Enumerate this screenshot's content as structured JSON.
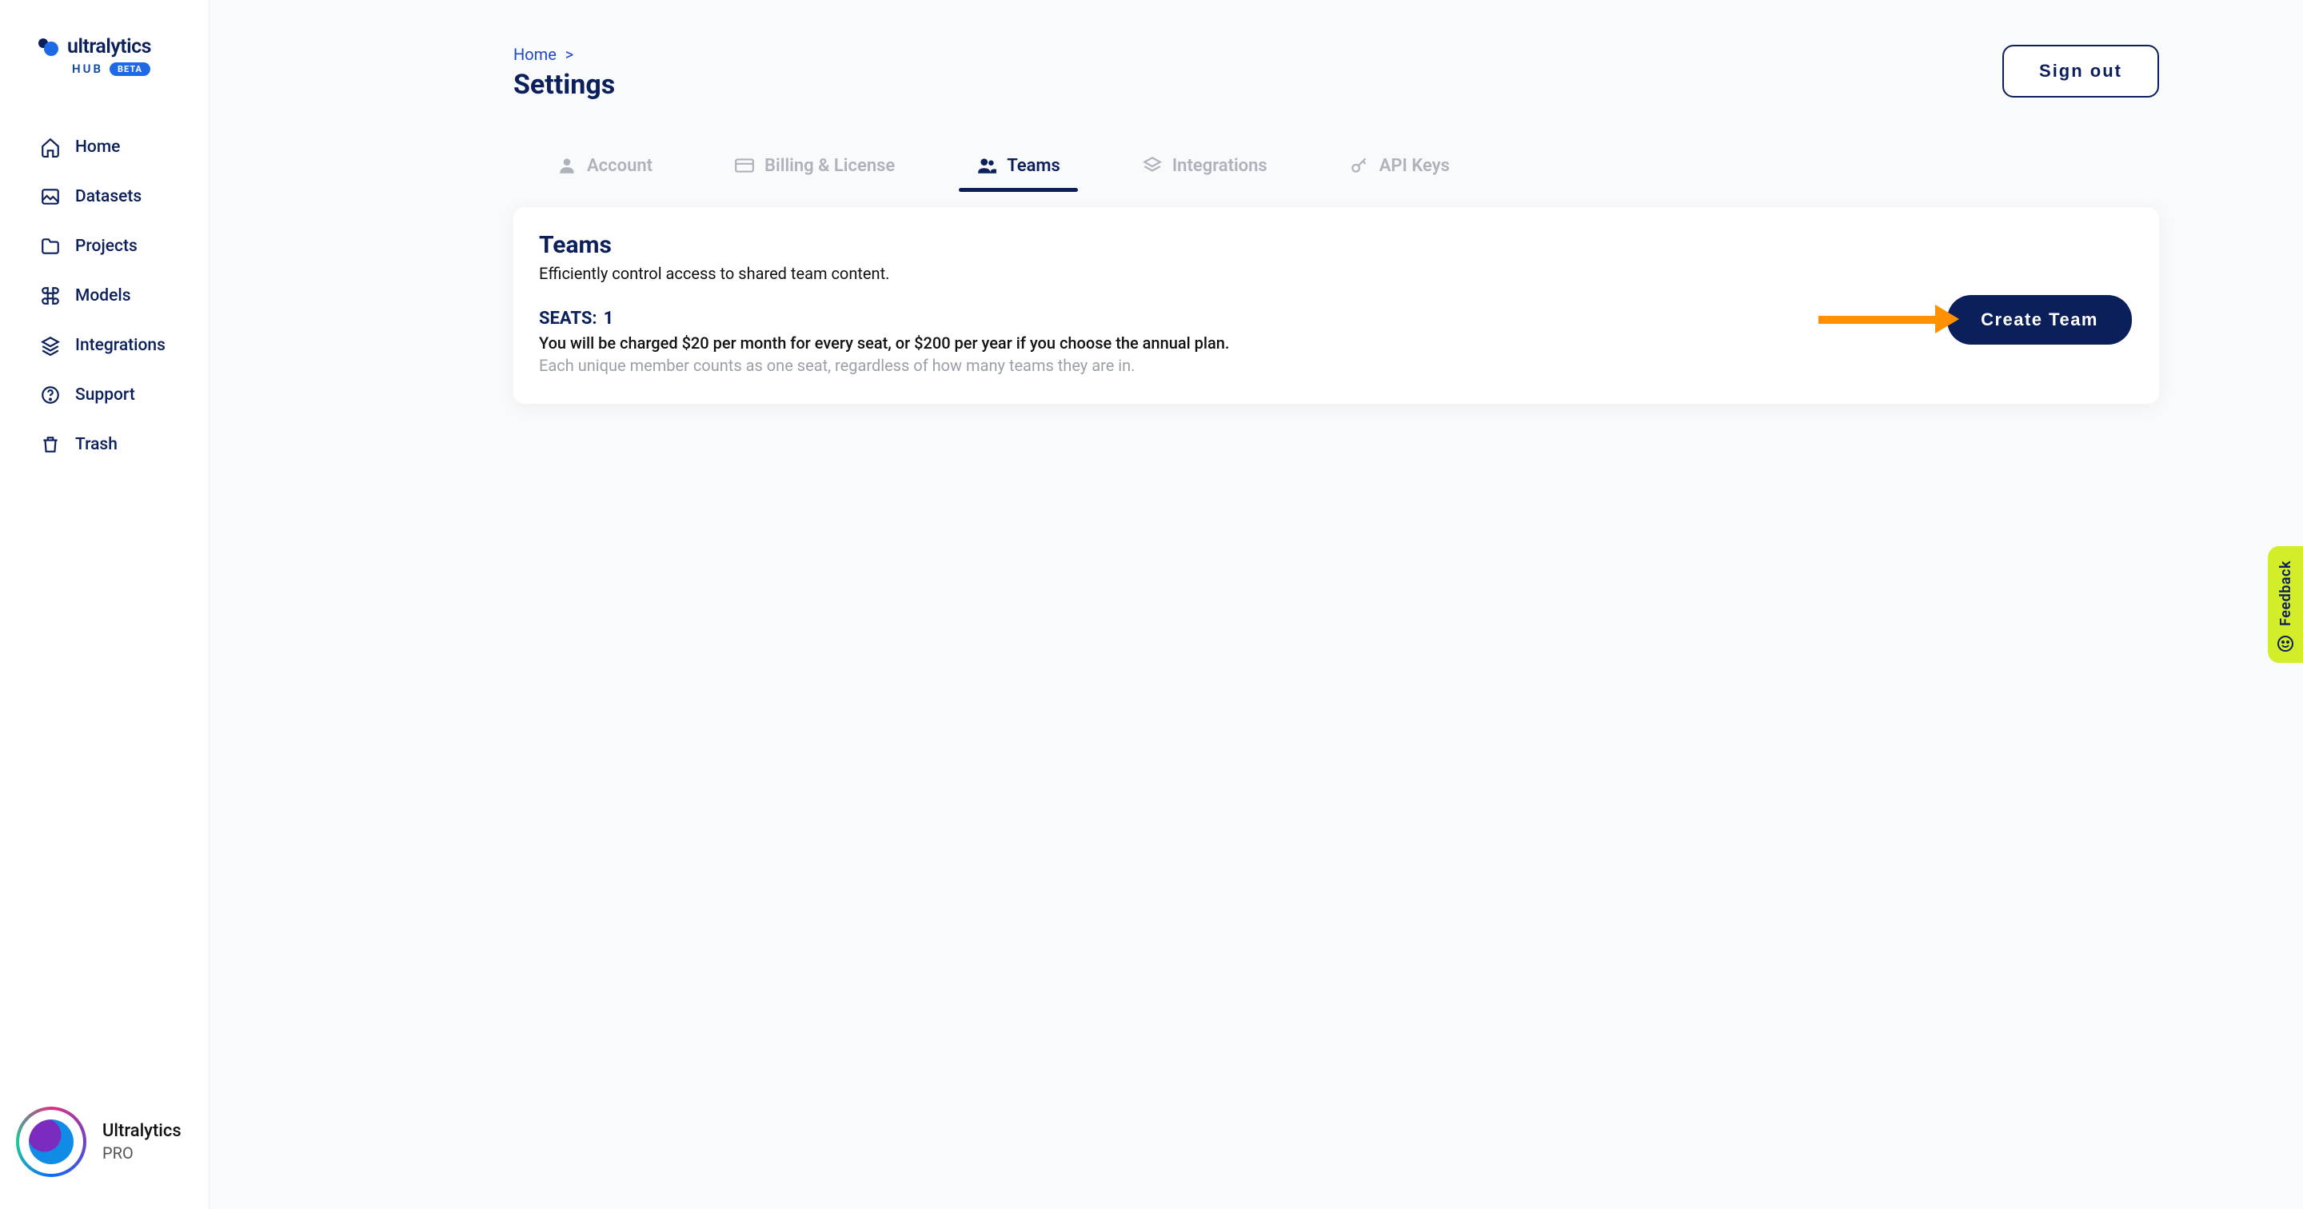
{
  "brand": {
    "name": "ultralytics",
    "sub1": "HUB",
    "badge": "BETA"
  },
  "sidebar": {
    "items": [
      {
        "label": "Home"
      },
      {
        "label": "Datasets"
      },
      {
        "label": "Projects"
      },
      {
        "label": "Models"
      },
      {
        "label": "Integrations"
      },
      {
        "label": "Support"
      },
      {
        "label": "Trash"
      }
    ]
  },
  "user": {
    "name": "Ultralytics",
    "plan": "PRO"
  },
  "breadcrumb": {
    "home": "Home",
    "sep": ">"
  },
  "page": {
    "title": "Settings"
  },
  "actions": {
    "signout": "Sign out",
    "create_team": "Create Team"
  },
  "tabs": [
    {
      "label": "Account"
    },
    {
      "label": "Billing & License"
    },
    {
      "label": "Teams"
    },
    {
      "label": "Integrations"
    },
    {
      "label": "API Keys"
    }
  ],
  "teams": {
    "heading": "Teams",
    "subtitle": "Efficiently control access to shared team content.",
    "seats_label": "SEATS:",
    "seats_value": "1",
    "charge_text": "You will be charged $20 per month for every seat, or $200 per year if you choose the annual plan.",
    "unique_text": "Each unique member counts as one seat, regardless of how many teams they are in."
  },
  "feedback": {
    "label": "Feedback"
  }
}
